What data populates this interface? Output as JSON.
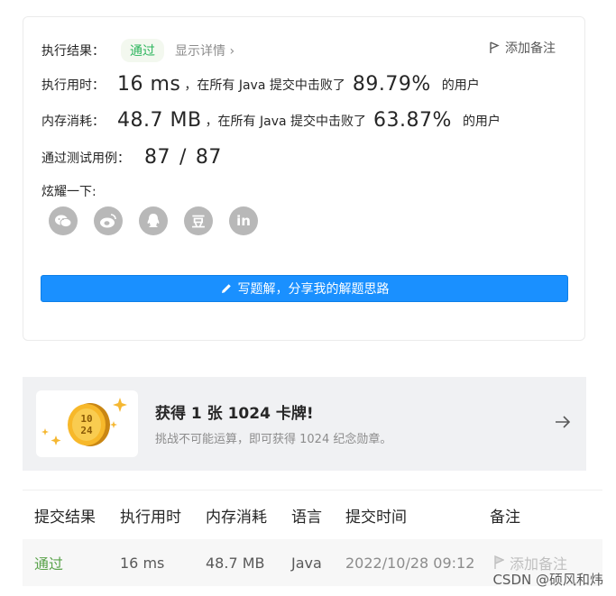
{
  "result": {
    "label": "执行结果：",
    "status": "通过",
    "detail_link": "显示详情",
    "add_note": "添加备注"
  },
  "runtime": {
    "label": "执行用时：",
    "value": "16 ms",
    "mid": "，在所有 Java 提交中击败了",
    "percent": "89.79%",
    "suffix": "的用户"
  },
  "memory": {
    "label": "内存消耗：",
    "value": "48.7 MB",
    "mid": "，在所有 Java 提交中击败了",
    "percent": "63.87%",
    "suffix": "的用户"
  },
  "tests": {
    "label": "通过测试用例：",
    "passed": "87",
    "sep": "/",
    "total": "87"
  },
  "share": {
    "label": "炫耀一下:",
    "icons": [
      "wechat-icon",
      "weibo-icon",
      "qq-icon",
      "douban-icon",
      "linkedin-icon"
    ],
    "douban_glyph": "豆",
    "linkedin_glyph": "in"
  },
  "write_solution_button": "写题解，分享我的解题思路",
  "promo": {
    "title": "获得 1 张 1024 卡牌!",
    "subtitle": "挑战不可能运算，即可获得 1024 纪念勋章。",
    "coin_top": "10",
    "coin_bottom": "24"
  },
  "table": {
    "headers": [
      "提交结果",
      "执行用时",
      "内存消耗",
      "语言",
      "提交时间",
      "备注"
    ],
    "rows": [
      {
        "result": "通过",
        "runtime": "16 ms",
        "memory": "48.7 MB",
        "language": "Java",
        "time": "2022/10/28 09:12",
        "note": "添加备注"
      }
    ]
  },
  "watermark": "CSDN @硕风和炜",
  "colors": {
    "accent": "#1a90ff",
    "success": "#2db55d",
    "muted": "#8c8c8c"
  }
}
